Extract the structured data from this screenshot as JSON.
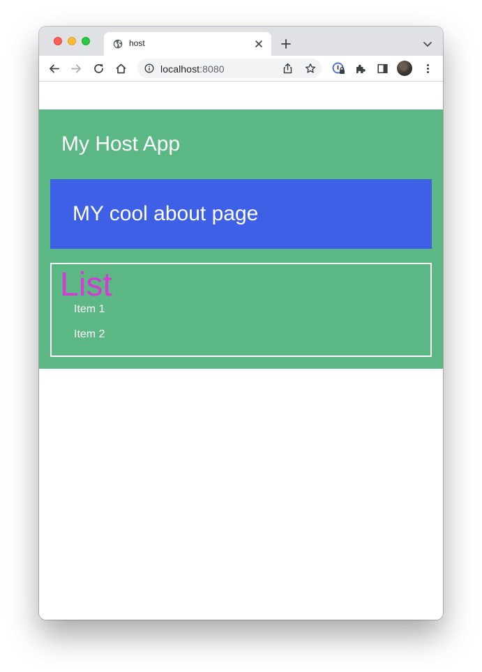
{
  "browser": {
    "tab": {
      "title": "host",
      "favicon": "globe-icon"
    },
    "address_bar": {
      "host": "localhost",
      "port": ":8080"
    },
    "toolbar_icons": [
      "back-icon",
      "forward-icon",
      "reload-icon",
      "home-icon",
      "share-icon",
      "star-icon",
      "password-manager-icon",
      "extensions-icon",
      "side-panel-icon",
      "profile-avatar",
      "more-menu-icon"
    ]
  },
  "page": {
    "host_title": "My Host App",
    "about_title": "MY cool about page",
    "list": {
      "heading": "List",
      "items": [
        "Item 1",
        "Item 2"
      ]
    }
  },
  "colors": {
    "host_background": "#5bb884",
    "about_background": "#3d60e6",
    "list_heading": "#d63ad6",
    "text": "#ffffff"
  }
}
